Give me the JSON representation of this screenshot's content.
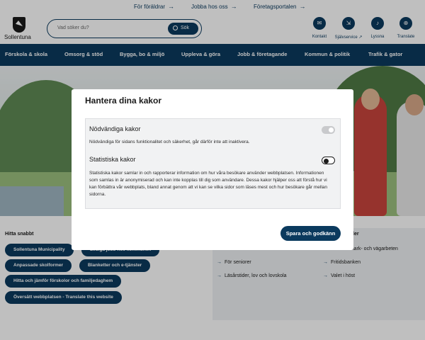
{
  "topbar": {
    "links": [
      {
        "label": "För föräldrar"
      },
      {
        "label": "Jobba hos oss"
      },
      {
        "label": "Företagsportalen"
      }
    ],
    "arrow": "→"
  },
  "header": {
    "logo_text": "Sollentuna",
    "search_placeholder": "Vad söker du?",
    "search_button": "Sök",
    "icons": [
      {
        "name": "contact-icon",
        "label": "Kontakt",
        "glyph": "✉"
      },
      {
        "name": "self-service-icon",
        "label": "Självservice ↗",
        "glyph": "⇲"
      },
      {
        "name": "listen-icon",
        "label": "Lyssna",
        "glyph": "♪"
      },
      {
        "name": "translate-icon",
        "label": "Translate",
        "glyph": "⊕"
      }
    ]
  },
  "nav": {
    "items": [
      {
        "label": "Förskola & skola"
      },
      {
        "label": "Omsorg & stöd"
      },
      {
        "label": "Bygga, bo & miljö"
      },
      {
        "label": "Uppleva & göra"
      },
      {
        "label": "Jobb & företagande"
      },
      {
        "label": "Kommun & politik"
      },
      {
        "label": "Trafik & gator"
      }
    ]
  },
  "quick": {
    "title": "Hitta snabbt",
    "pills": [
      {
        "label": "Sollentuna Municipality"
      },
      {
        "label": "Lediga jobb hos kommunen"
      },
      {
        "label": "Anpassade skolformer"
      },
      {
        "label": "Blanketter och e-tjänster"
      },
      {
        "label": "Hitta och jämför förskolor och familjedaghem"
      },
      {
        "label": "Översätt webbplatsen - Translate this website"
      }
    ]
  },
  "panel": {
    "title_fragment": "ler",
    "links": [
      {
        "label": "För seniorer"
      },
      {
        "label": "Läsårstider, lov och lovskola"
      },
      {
        "label": "Aktuella mark- och vägarbeten"
      },
      {
        "label": "Fritidsbanken"
      },
      {
        "label": "Valet i höst"
      }
    ]
  },
  "cookie_modal": {
    "title": "Hantera dina kakor",
    "categories": [
      {
        "title": "Nödvändiga kakor",
        "description": "Nödvändiga för sidans funktionalitet och säkerhet, går därför inte att inaktivera.",
        "enabled": true,
        "disabled": true
      },
      {
        "title": "Statistiska kakor",
        "description": "Statistiska kakor samlar in och rapporterar information om hur våra besökare använder webbplatsen. Informationen som samlas in är anonymiserad och kan inte kopplas till dig som användare. Dessa kakor hjälper oss att förstå hur vi kan förbättra vår webbplats, bland annat genom att vi kan se vilka sidor som läses mest och hur besökare går mellan sidorna.",
        "enabled": false,
        "disabled": false
      }
    ],
    "save_button": "Spara och godkänn"
  },
  "colors": {
    "brand_navy": "#0b3a5e",
    "overlay": "rgba(0,0,0,0.25)"
  }
}
